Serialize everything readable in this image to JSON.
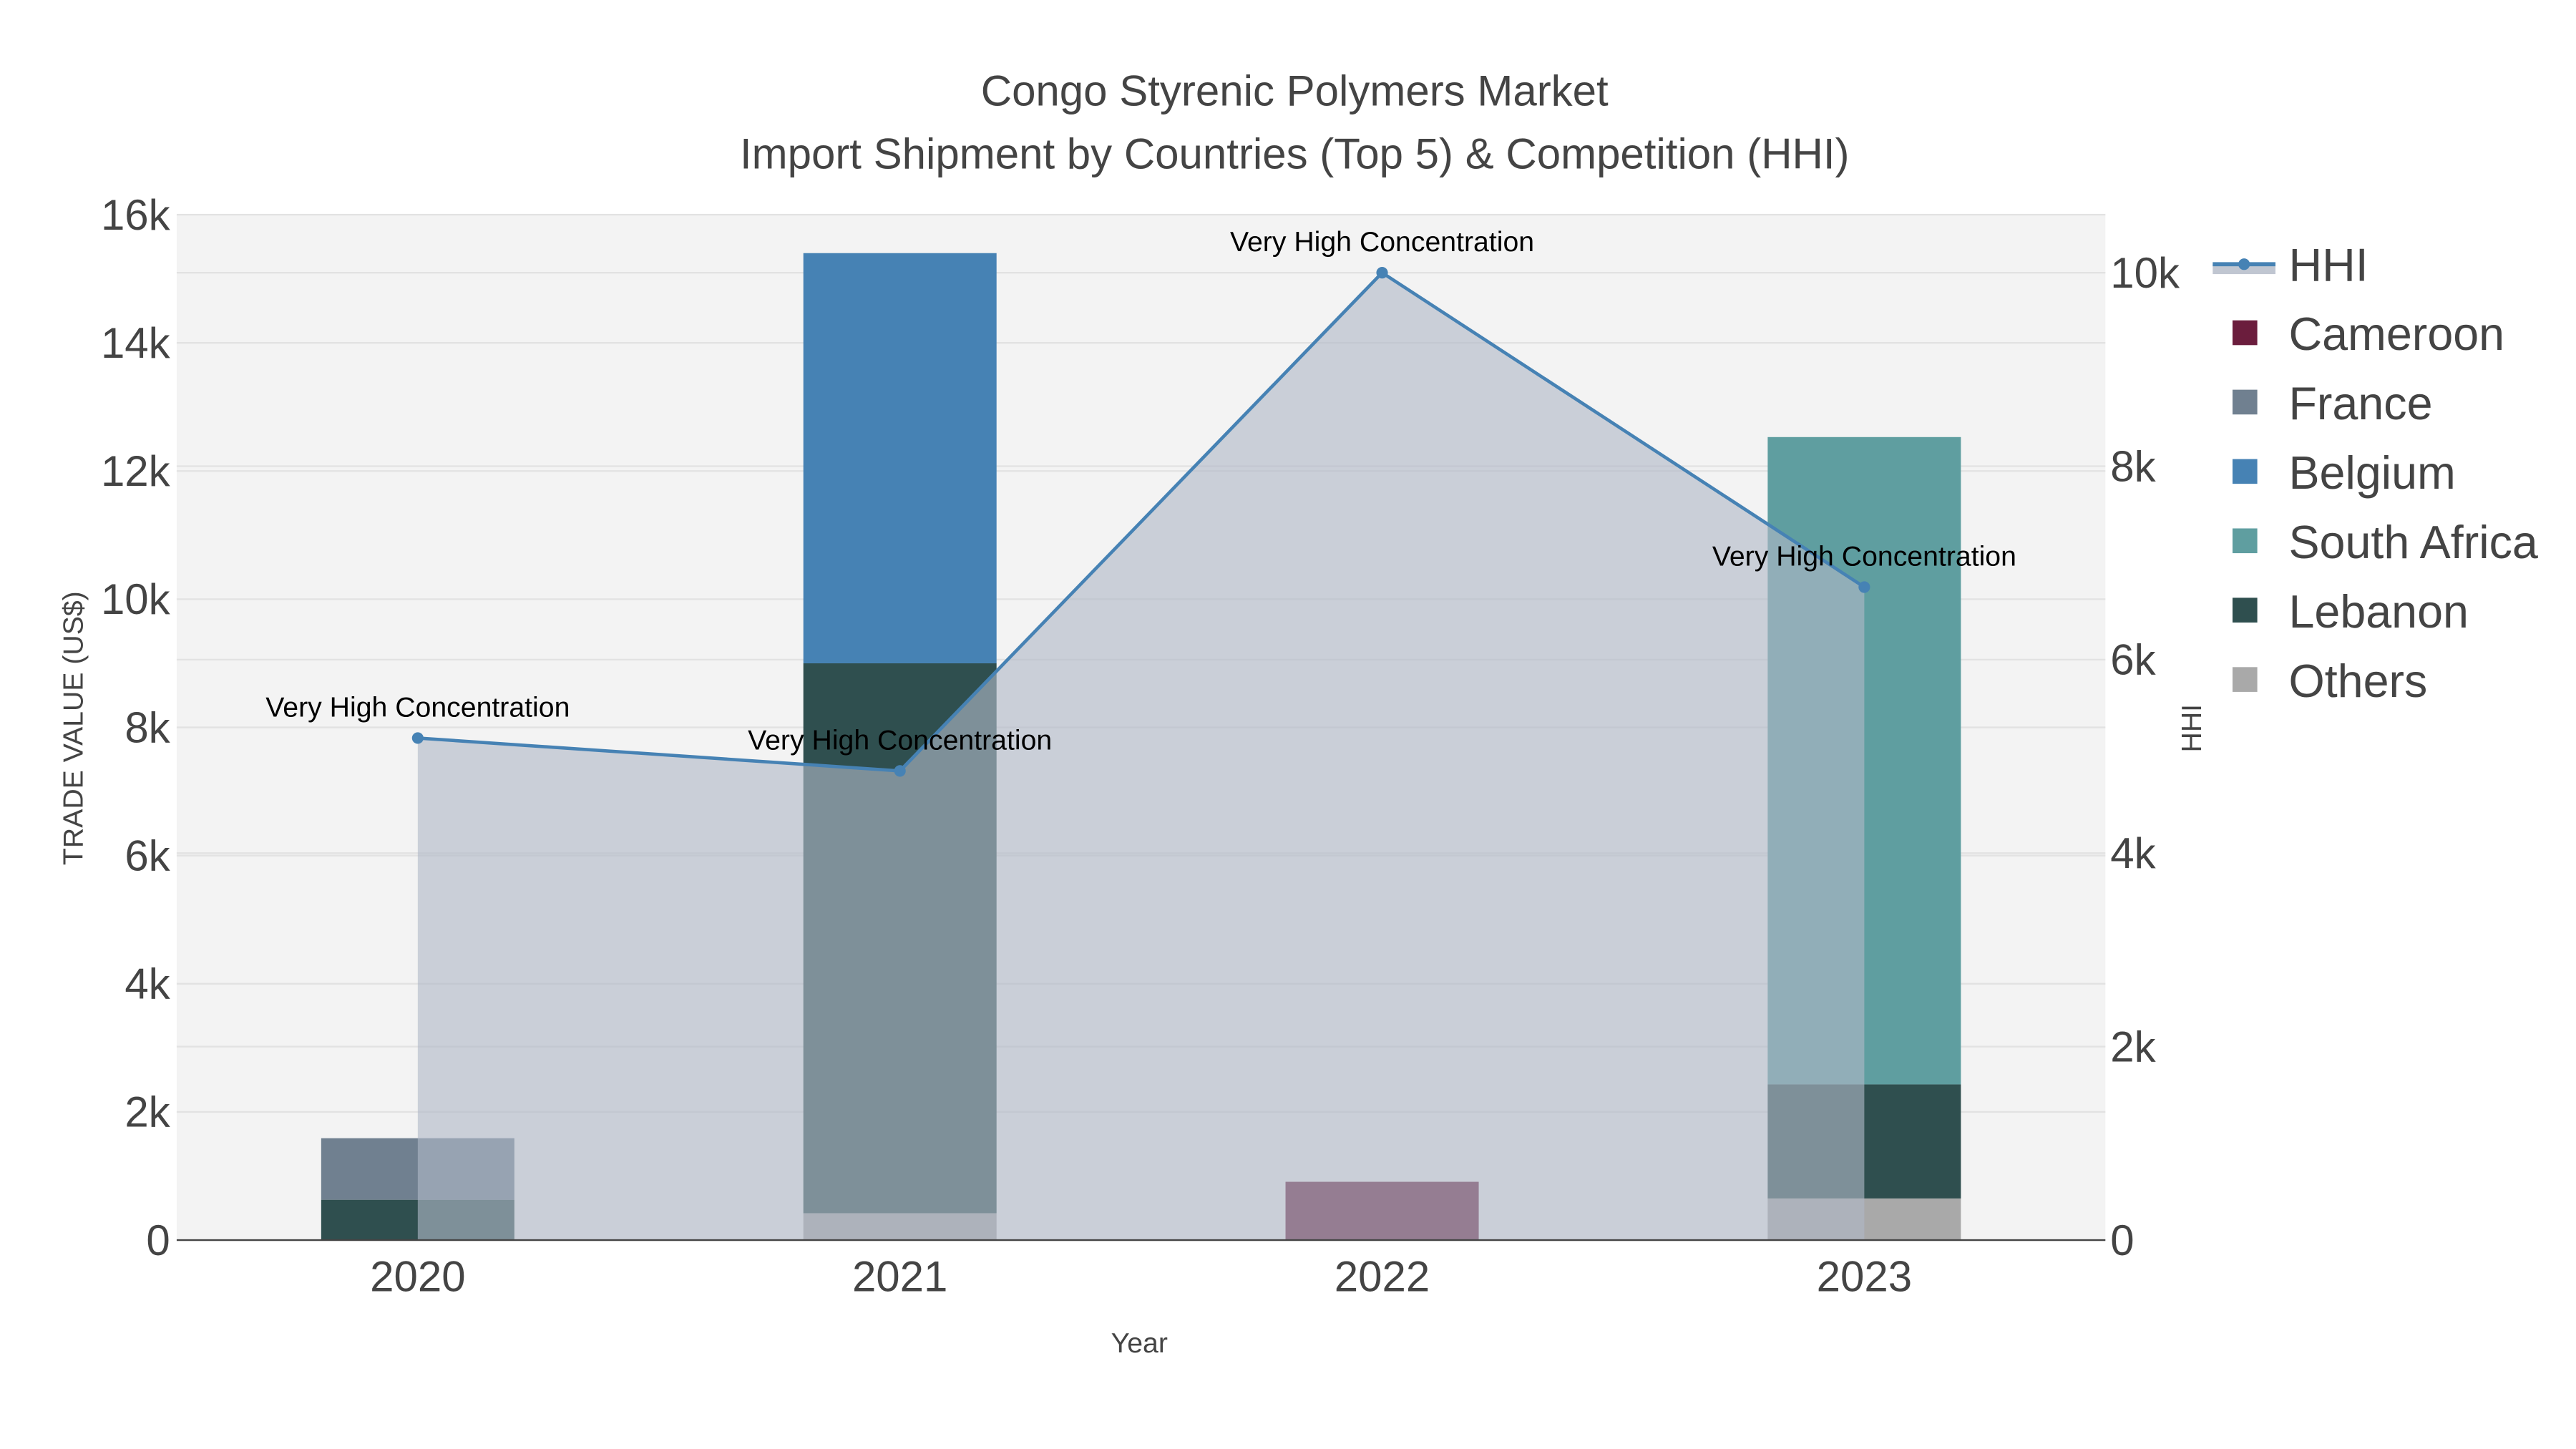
{
  "chart_data": {
    "type": "bar",
    "title_line1": "Congo Styrenic Polymers Market",
    "title_line2": "Import Shipment by Countries (Top 5) & Competition (HHI)",
    "xlabel": "Year",
    "ylabel": "TRADE VALUE (US$)",
    "y2label": "HHI",
    "categories": [
      "2020",
      "2021",
      "2022",
      "2023"
    ],
    "ylim": [
      0,
      16000
    ],
    "yticks": [
      0,
      2000,
      4000,
      6000,
      8000,
      10000,
      12000,
      14000,
      16000
    ],
    "ytick_labels": [
      "0",
      "2k",
      "4k",
      "6k",
      "8k",
      "10k",
      "12k",
      "14k",
      "16k"
    ],
    "y2lim": [
      0,
      10600
    ],
    "y2ticks": [
      0,
      2000,
      4000,
      6000,
      8000,
      10000
    ],
    "y2tick_labels": [
      "0",
      "2k",
      "4k",
      "6k",
      "8k",
      "10k"
    ],
    "stacked": true,
    "series": [
      {
        "name": "Others",
        "color": "#a9a9a9",
        "values": [
          0,
          420,
          0,
          650
        ]
      },
      {
        "name": "Lebanon",
        "color": "#2f4f4f",
        "values": [
          630,
          8580,
          0,
          1780
        ]
      },
      {
        "name": "South Africa",
        "color": "#5f9ea0",
        "values": [
          0,
          0,
          0,
          10100
        ]
      },
      {
        "name": "Belgium",
        "color": "#4682b4",
        "values": [
          0,
          6400,
          0,
          0
        ]
      },
      {
        "name": "France",
        "color": "#708090",
        "values": [
          960,
          0,
          0,
          0
        ]
      },
      {
        "name": "Cameroon",
        "color": "#6b1d3d",
        "values": [
          0,
          0,
          910,
          0
        ]
      }
    ],
    "hhi": {
      "name": "HHI",
      "color": "#4682b4",
      "values": [
        5190,
        4850,
        10000,
        6750
      ],
      "annotations": [
        "Very High Concentration",
        "Very High Concentration",
        "Very High Concentration",
        "Very High Concentration"
      ]
    },
    "legend": [
      "HHI",
      "Cameroon",
      "France",
      "Belgium",
      "South Africa",
      "Lebanon",
      "Others"
    ],
    "legend_placement": "right",
    "grid": true
  }
}
